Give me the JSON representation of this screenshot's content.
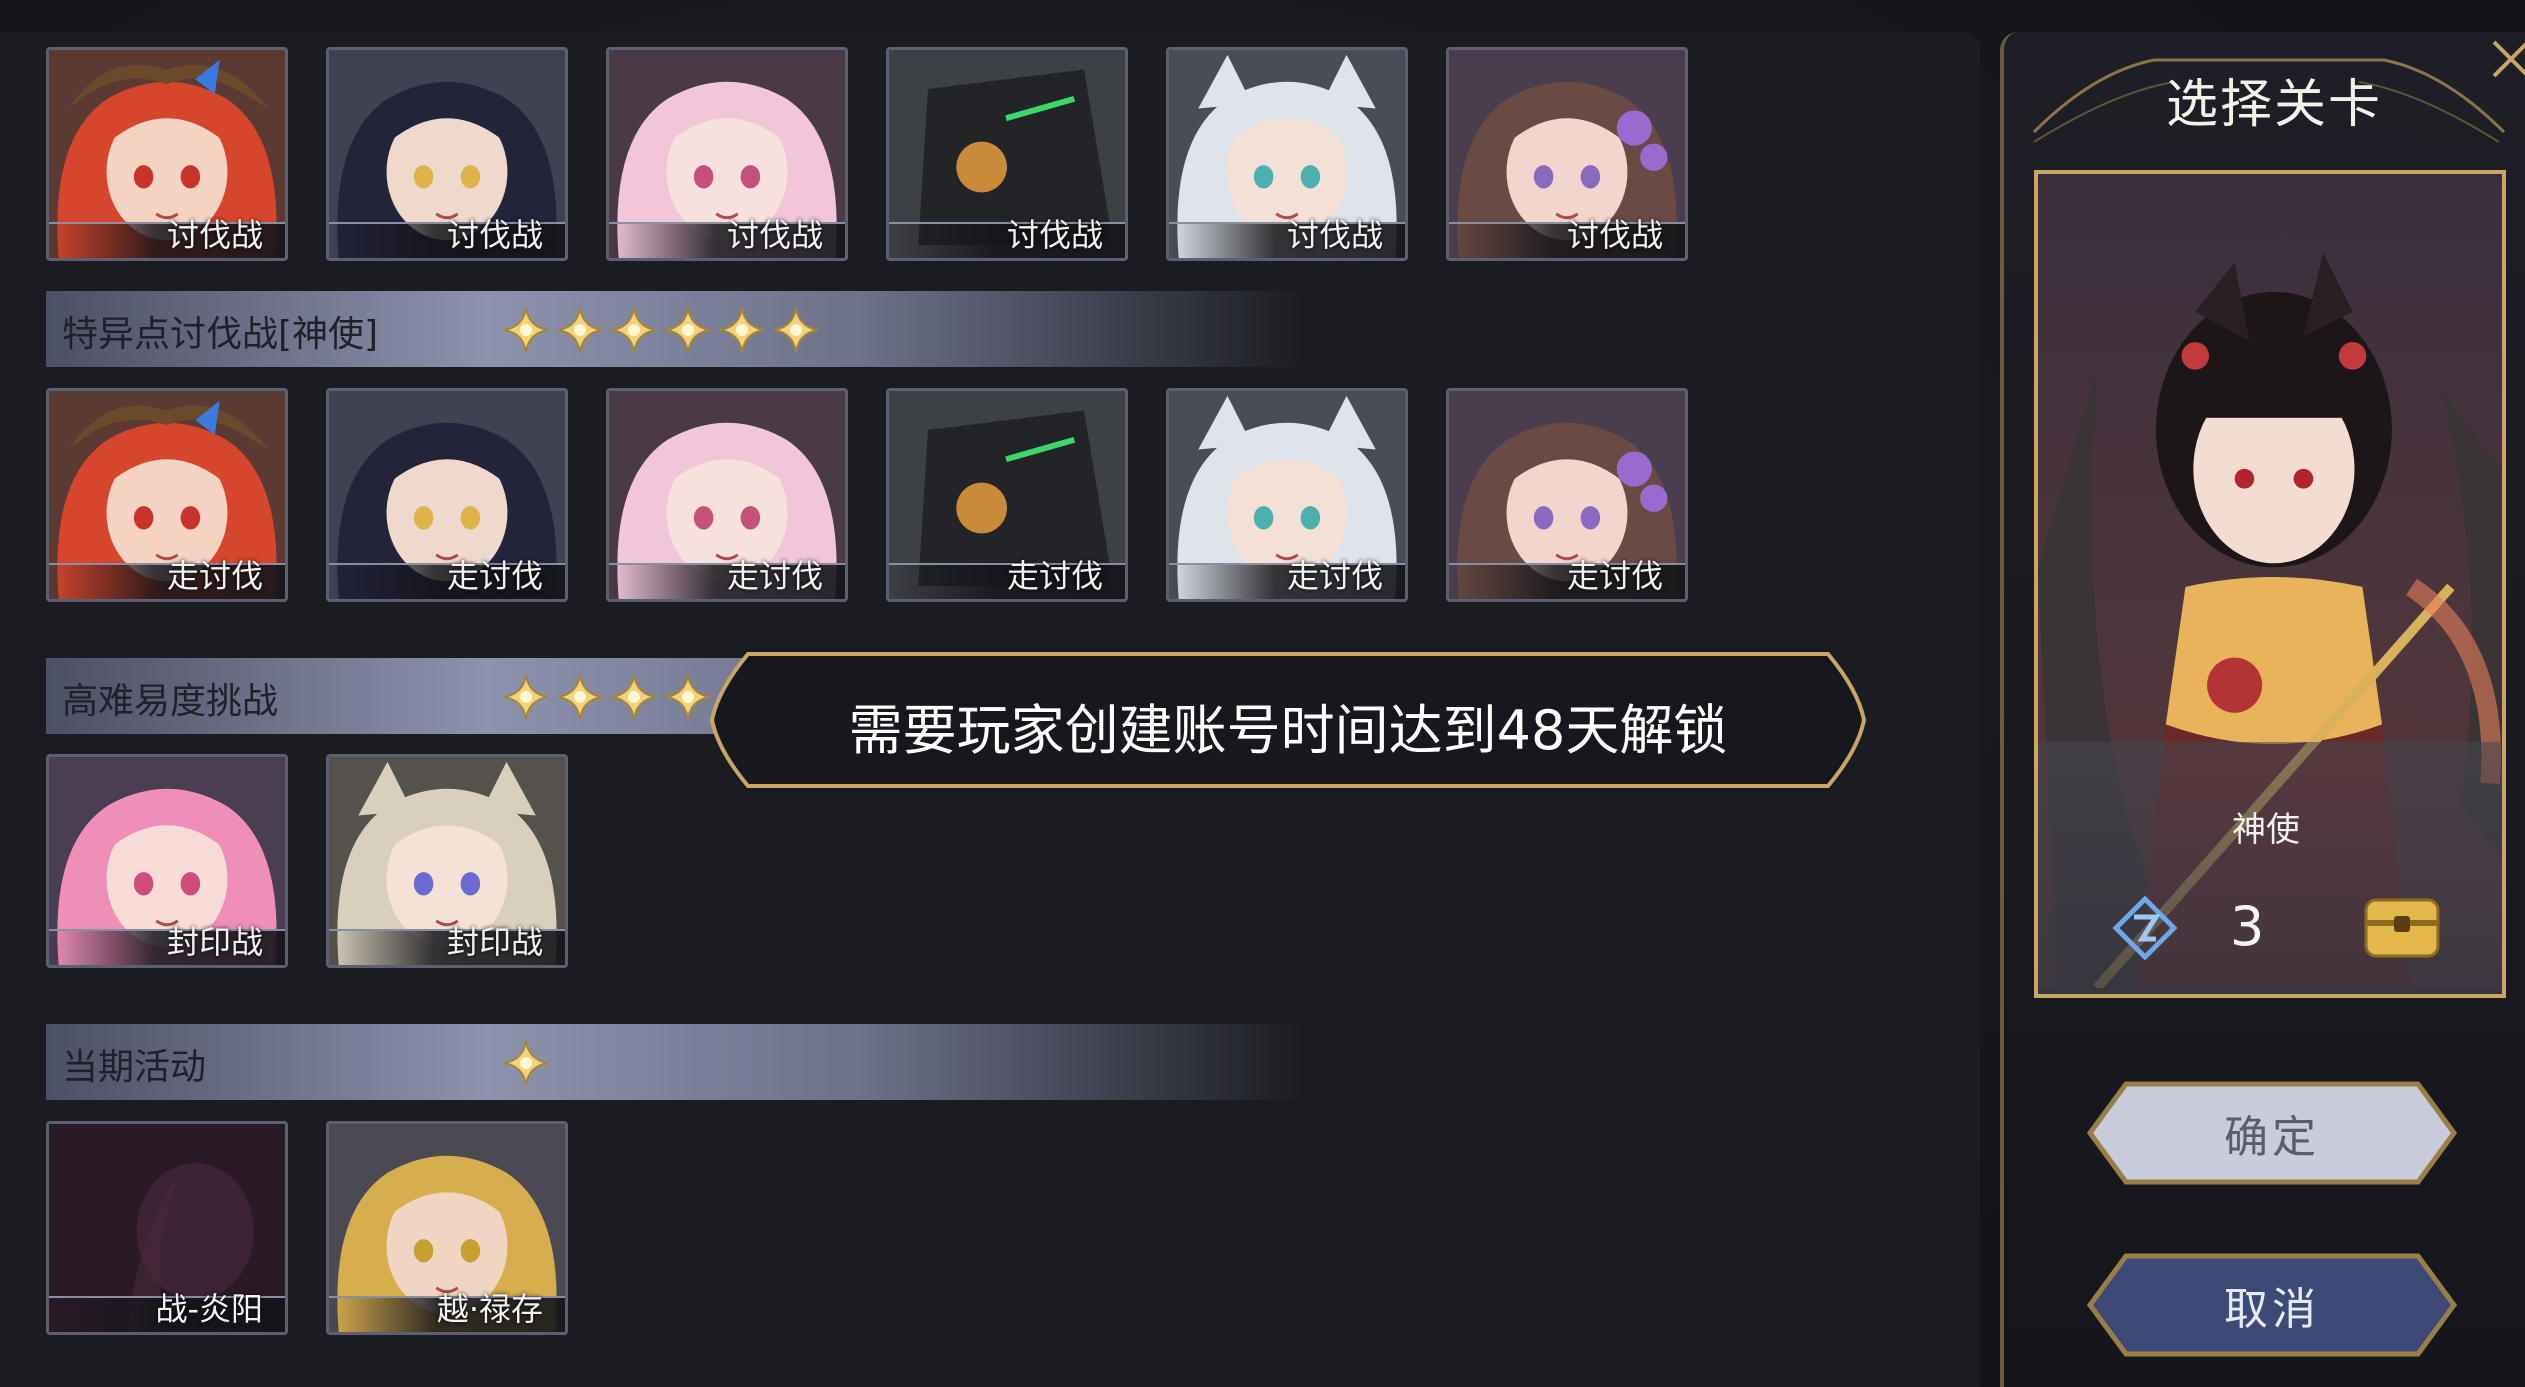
{
  "colors": {
    "accent_gold": "#c9a662",
    "section_bar": "#8d93ac",
    "star_gold": "#f2d27a",
    "panel_bg": "#1b1c21",
    "cancel_button": "#3d4a78",
    "ok_button": "#c9ccdb"
  },
  "rows": {
    "row1": {
      "cards": [
        {
          "label": "讨伐战",
          "icon": "portrait-red-hair-horned"
        },
        {
          "label": "讨伐战",
          "icon": "portrait-dark-long-hair"
        },
        {
          "label": "讨伐战",
          "icon": "portrait-pink-hair"
        },
        {
          "label": "讨伐战",
          "icon": "portrait-mech-helmet"
        },
        {
          "label": "讨伐战",
          "icon": "portrait-silver-hair-hood"
        },
        {
          "label": "讨伐战",
          "icon": "portrait-brown-hair-flowers"
        }
      ]
    },
    "section_shenshi": {
      "title": "特异点讨伐战[神使]",
      "stars": 6
    },
    "row2": {
      "cards": [
        {
          "label": "走讨伐",
          "icon": "portrait-red-hair-horned"
        },
        {
          "label": "走讨伐",
          "icon": "portrait-dark-long-hair"
        },
        {
          "label": "走讨伐",
          "icon": "portrait-pink-hair"
        },
        {
          "label": "走讨伐",
          "icon": "portrait-mech-helmet"
        },
        {
          "label": "走讨伐",
          "icon": "portrait-silver-hair-hood"
        },
        {
          "label": "走讨伐",
          "icon": "portrait-brown-hair-flowers"
        }
      ]
    },
    "section_hard": {
      "title": "高难易度挑战",
      "stars": 8
    },
    "row3": {
      "cards": [
        {
          "label": "封印战",
          "icon": "portrait-pink-hair-bow"
        },
        {
          "label": "封印战",
          "icon": "portrait-blonde-wolf-ears"
        }
      ]
    },
    "section_event": {
      "title": "当期活动",
      "stars": 1
    },
    "row4": {
      "cards": [
        {
          "label": "战-炎阳",
          "icon": "portrait-dark-horn"
        },
        {
          "label": "越·禄存",
          "icon": "portrait-blonde-man"
        }
      ]
    }
  },
  "right_panel": {
    "title": "选择关卡",
    "selected_name": "神使",
    "cost_icon": "stage-token-icon",
    "cost_value": "3",
    "reward_icon": "treasure-chest-icon",
    "ok_label": "确定",
    "cancel_label": "取消"
  },
  "toast": {
    "message": "需要玩家创建账号时间达到48天解锁"
  }
}
